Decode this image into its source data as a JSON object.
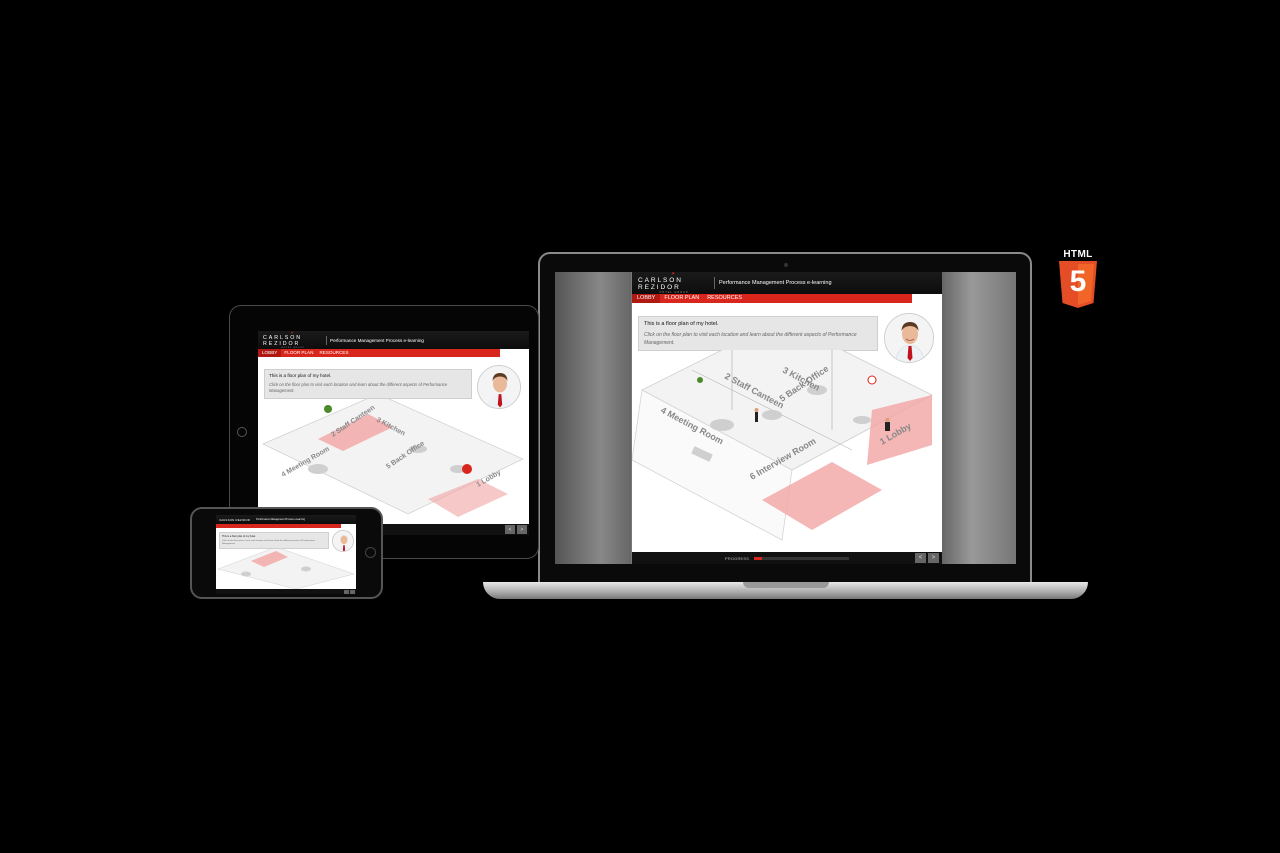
{
  "brand": {
    "logo_text": "CARLSON REZIDOR",
    "logo_sub": "HOTEL GROUP",
    "accent": "#d9261c"
  },
  "course": {
    "title": "Performance Management Process e-learning"
  },
  "nav": {
    "items": [
      {
        "label": "LOBBY"
      },
      {
        "label": "FLOOR PLAN"
      },
      {
        "label": "RESOURCES"
      }
    ]
  },
  "content": {
    "message": "This is a floor plan of my hotel.",
    "instruction": "Click on the floor plan to visit each location and learn about the different aspects of Performance Management."
  },
  "rooms": {
    "kitchen": "3 Kitchen",
    "canteen": "2 Staff Canteen",
    "office": "5 Back Office",
    "meeting": "4 Meeting Room",
    "interview": "6 Interview Room",
    "lobby": "1 Lobby"
  },
  "footer": {
    "progress_label": "PROGRESS",
    "progress": 0.08,
    "prev_icon": "chevron-left-icon",
    "next_icon": "chevron-right-icon",
    "prev_glyph": "<",
    "next_glyph": ">"
  },
  "badge": {
    "top": "HTML",
    "number": "5",
    "color": "#e44d26"
  }
}
